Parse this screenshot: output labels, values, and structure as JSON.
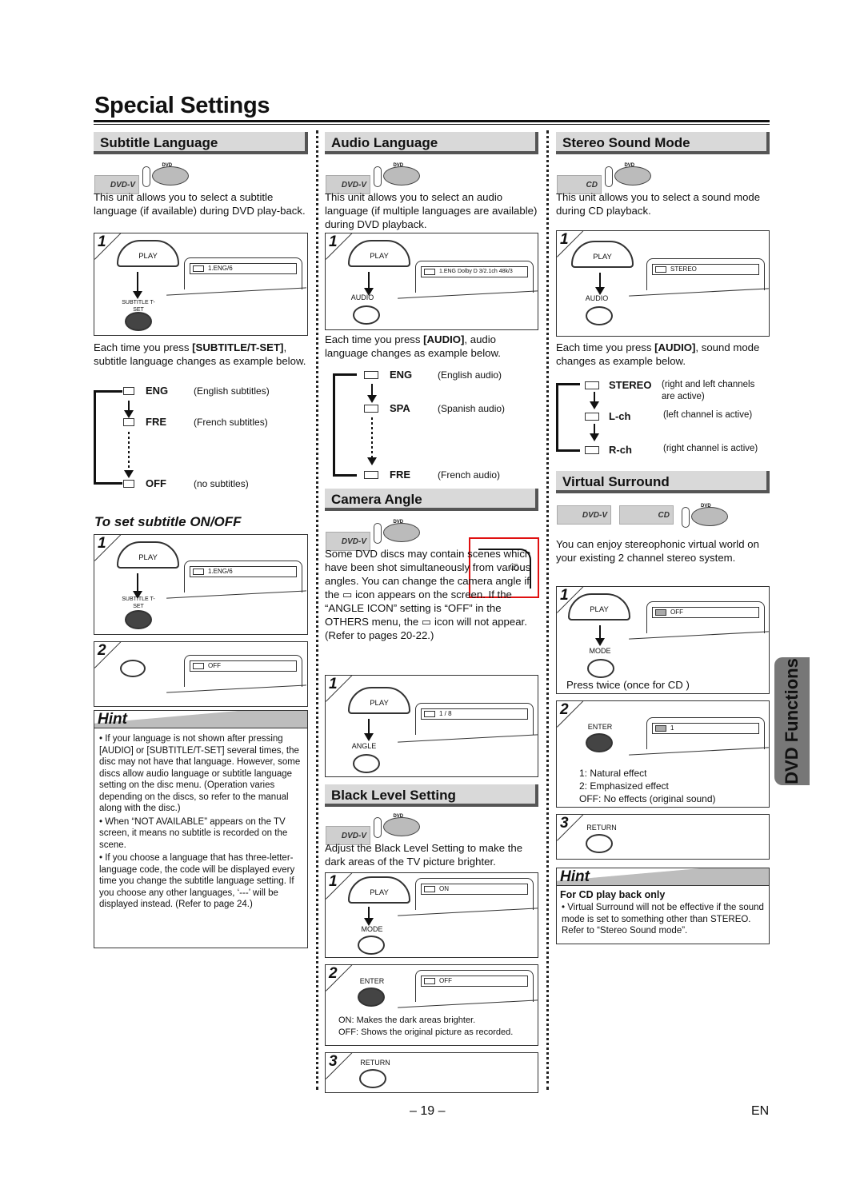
{
  "page": {
    "title": "Special Settings",
    "page_number": "– 19 –",
    "language": "EN",
    "side_tab": "DVD Functions"
  },
  "badges": {
    "dvdv": "DVD-V",
    "cd": "CD",
    "dvd": "DVD"
  },
  "subtitle": {
    "heading": "Subtitle Language",
    "intro": "This unit allows you to select a subtitle language (if available) during DVD play-back.",
    "step1": {
      "num": "1",
      "play": "PLAY",
      "button": "SUBTITLE T-SET",
      "osd": "1.ENG/6"
    },
    "instruction_pre": "Each time you press ",
    "instruction_key": "[SUBTITLE/T-SET]",
    "instruction_post": ", subtitle language changes as example below.",
    "options": [
      {
        "code": "ENG",
        "desc": "(English subtitles)"
      },
      {
        "code": "FRE",
        "desc": "(French subtitles)"
      },
      {
        "code": "OFF",
        "desc": "(no subtitles)"
      }
    ],
    "onoff_heading": "To set subtitle ON/OFF",
    "onoff_step1": {
      "num": "1",
      "play": "PLAY",
      "button": "SUBTITLE T-SET",
      "osd": "1.ENG/6"
    },
    "onoff_step2": {
      "num": "2",
      "osd": "OFF"
    },
    "hint": {
      "title": "Hint",
      "items": [
        "If your language is not shown after pressing [AUDIO] or [SUBTITLE/T-SET] several times, the disc may not have that language. However, some discs allow audio language or subtitle language setting on the disc menu. (Operation varies depending on the discs, so refer to the manual along with the disc.)",
        "When “NOT AVAILABLE” appears on the TV screen, it means no subtitle is recorded on the scene.",
        "If you choose a language that has three-letter-language code, the code will be displayed every time you change the subtitle language setting. If you choose any other languages, ‘---’ will be displayed instead. (Refer to page 24.)"
      ]
    }
  },
  "audio": {
    "heading": "Audio Language",
    "intro": "This unit allows you to select an audio language (if multiple languages are available) during DVD playback.",
    "step1": {
      "num": "1",
      "play": "PLAY",
      "button": "AUDIO",
      "osd": "1.ENG  Dolby D  3/2.1ch  48k/3"
    },
    "instruction_pre": "Each time you press ",
    "instruction_key": "[AUDIO]",
    "instruction_post": ", audio language changes as example below.",
    "options": [
      {
        "code": "ENG",
        "desc": "(English audio)"
      },
      {
        "code": "SPA",
        "desc": "(Spanish audio)"
      },
      {
        "code": "FRE",
        "desc": "(French audio)"
      }
    ]
  },
  "camera": {
    "heading": "Camera Angle",
    "text": "Some DVD discs may contain scenes which have been shot simultaneously from various angles. You can change the camera angle if the ▭ icon appears on the screen. If the “ANGLE ICON” setting is “OFF” in the OTHERS menu, the ▭ icon will not appear. (Refer to pages 20-22.)",
    "step1": {
      "num": "1",
      "play": "PLAY",
      "button": "ANGLE",
      "osd": "1 / 8"
    }
  },
  "black": {
    "heading": "Black Level Setting",
    "intro": "Adjust the Black Level Setting to make the dark areas of the TV picture brighter.",
    "step1": {
      "num": "1",
      "play": "PLAY",
      "button": "MODE",
      "osd": "ON"
    },
    "step2": {
      "num": "2",
      "button": "ENTER",
      "osd": "OFF",
      "notes": [
        "ON: Makes the dark areas brighter.",
        "OFF: Shows the original picture as recorded."
      ]
    },
    "step3": {
      "num": "3",
      "button": "RETURN"
    }
  },
  "stereo": {
    "heading": "Stereo Sound Mode",
    "intro": "This unit allows you to select a sound mode during CD playback.",
    "step1": {
      "num": "1",
      "play": "PLAY",
      "button": "AUDIO",
      "osd": "STEREO"
    },
    "instruction_pre": "Each time you press ",
    "instruction_key": "[AUDIO]",
    "instruction_post": ", sound mode changes as example below.",
    "options": [
      {
        "code": "STEREO",
        "desc": "(right and left channels are active)"
      },
      {
        "code": "L-ch",
        "desc": "(left channel is active)"
      },
      {
        "code": "R-ch",
        "desc": "(right channel is active)"
      }
    ]
  },
  "virtual": {
    "heading": "Virtual Surround",
    "intro": "You can enjoy stereophonic virtual world on your existing 2 channel stereo system.",
    "step1": {
      "num": "1",
      "play": "PLAY",
      "button": "MODE",
      "osd": "OFF",
      "note": "Press twice (once for CD )"
    },
    "step2": {
      "num": "2",
      "button": "ENTER",
      "osd": "1",
      "notes": [
        "1: Natural effect",
        "2: Emphasized effect",
        "OFF: No effects (original sound)"
      ]
    },
    "step3": {
      "num": "3",
      "button": "RETURN"
    },
    "hint": {
      "title": "Hint",
      "subtitle": "For CD play back only",
      "items": [
        "Virtual Surround will not be effective if the sound mode is set to something other than STEREO. Refer to “Stereo Sound mode”."
      ]
    }
  }
}
